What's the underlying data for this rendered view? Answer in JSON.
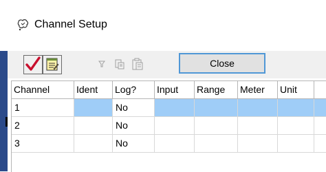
{
  "window": {
    "title": "Channel Setup",
    "icon": "channel-setup-icon"
  },
  "toolbar": {
    "buttons": [
      {
        "name": "checkmark-button",
        "icon": "red-checkmark-icon",
        "enabled": true
      },
      {
        "name": "notepad-button",
        "icon": "notepad-icon",
        "enabled": true
      },
      {
        "name": "filter-button",
        "icon": "funnel-icon",
        "enabled": false
      },
      {
        "name": "copy-button",
        "icon": "copy-icon",
        "enabled": false
      },
      {
        "name": "paste-button",
        "icon": "clipboard-icon",
        "enabled": false
      }
    ],
    "close_label": "Close"
  },
  "grid": {
    "columns": [
      "Channel",
      "Ident",
      "Log?",
      "Input",
      "Range",
      "Meter",
      "Unit"
    ],
    "rows": [
      {
        "channel": "1",
        "ident": "",
        "log": "No",
        "input": "",
        "range": "",
        "meter": "",
        "unit": "",
        "selected": true
      },
      {
        "channel": "2",
        "ident": "",
        "log": "No",
        "input": "",
        "range": "",
        "meter": "",
        "unit": "",
        "selected": false
      },
      {
        "channel": "3",
        "ident": "",
        "log": "No",
        "input": "",
        "range": "",
        "meter": "",
        "unit": "",
        "selected": false
      }
    ]
  },
  "colors": {
    "selection": "#9fcdf7",
    "close_border": "#4f97d6",
    "left_edge": "#2b4a8a"
  }
}
